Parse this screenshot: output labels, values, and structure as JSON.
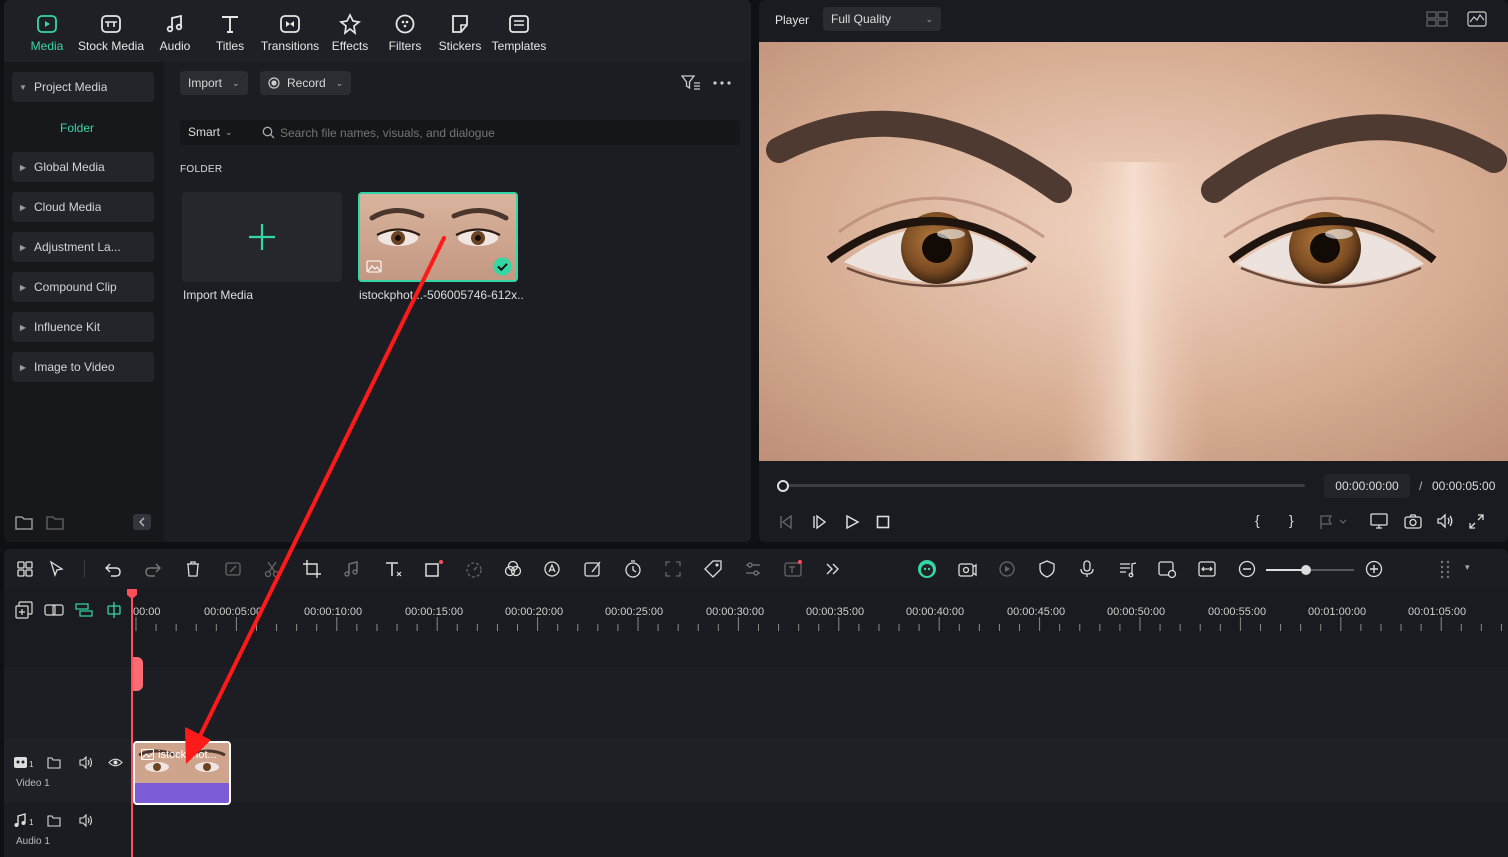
{
  "top_tabs": [
    {
      "label": "Media",
      "icon": "media-icon",
      "active": true
    },
    {
      "label": "Stock Media",
      "icon": "stock-media-icon"
    },
    {
      "label": "Audio",
      "icon": "music-note-icon"
    },
    {
      "label": "Titles",
      "icon": "text-t-icon"
    },
    {
      "label": "Transitions",
      "icon": "transitions-icon"
    },
    {
      "label": "Effects",
      "icon": "effects-icon"
    },
    {
      "label": "Filters",
      "icon": "filters-icon"
    },
    {
      "label": "Stickers",
      "icon": "stickers-icon"
    },
    {
      "label": "Templates",
      "icon": "templates-icon"
    }
  ],
  "sidebar": {
    "project_media": "Project Media",
    "folder": "Folder",
    "items": [
      "Global Media",
      "Cloud Media",
      "Adjustment La...",
      "Compound Clip",
      "Influence Kit",
      "Image to Video"
    ]
  },
  "toolbar": {
    "import_label": "Import",
    "record_label": "Record"
  },
  "search": {
    "smart_label": "Smart",
    "placeholder": "Search file names, visuals, and dialogue"
  },
  "folder_heading": "FOLDER",
  "media_items": [
    {
      "label": "Import Media",
      "type": "import"
    },
    {
      "label": "istockphot...-506005746-612x...",
      "type": "image",
      "selected": true
    }
  ],
  "player": {
    "label": "Player",
    "quality": "Full Quality",
    "current_time": "00:00:00:00",
    "separator": "/",
    "total_time": "00:00:05:00",
    "progress": 0
  },
  "timeline": {
    "ruler_labels": [
      "00:00",
      "00:00:05:00",
      "00:00:10:00",
      "00:00:15:00",
      "00:00:20:00",
      "00:00:25:00",
      "00:00:30:00",
      "00:00:35:00",
      "00:00:40:00",
      "00:00:45:00",
      "00:00:50:00",
      "00:00:55:00",
      "00:01:00:00",
      "00:01:05:00"
    ],
    "tracks": [
      {
        "name": "Video 1",
        "number": "1"
      },
      {
        "name": "Audio 1",
        "number": "1"
      }
    ],
    "clip_label": "istockphot...",
    "zoom_level": 0.45
  },
  "colors": {
    "accent": "#35d6a6",
    "playhead": "#ff4d5a",
    "clip": "#7b5bd6",
    "arrow": "#ff1a1a"
  }
}
